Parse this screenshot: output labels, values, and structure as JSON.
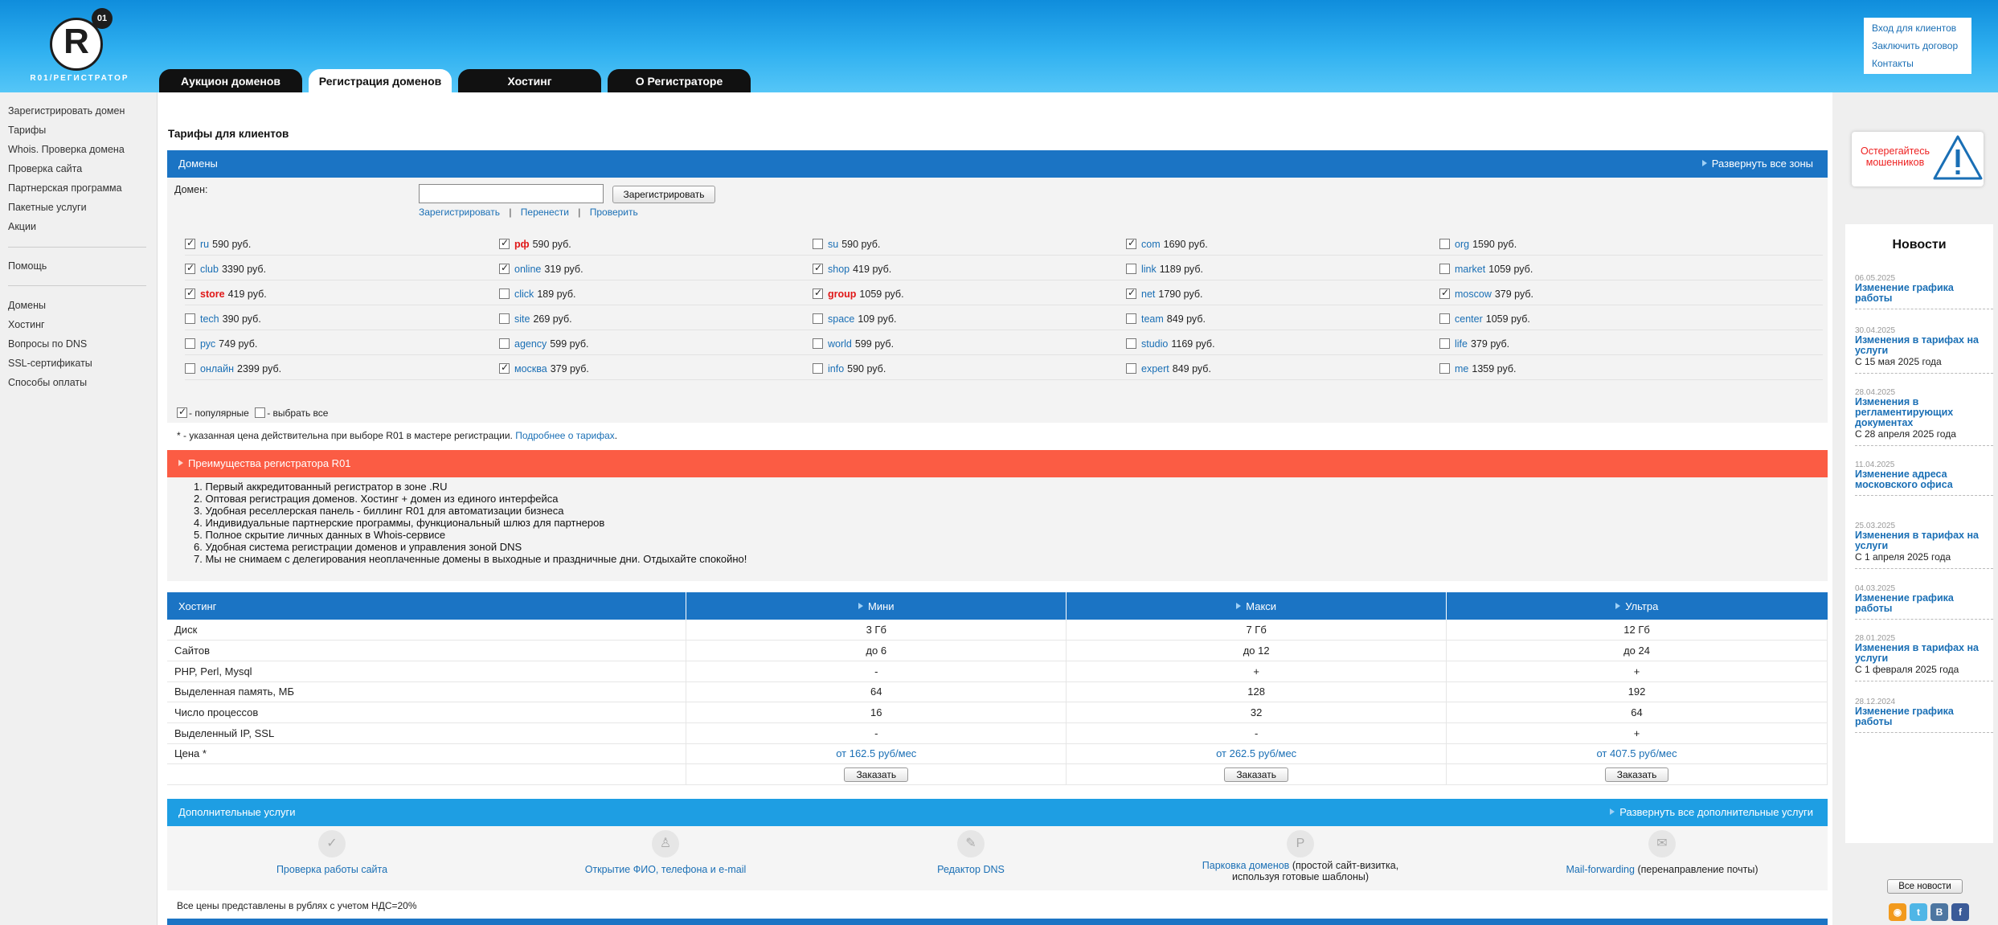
{
  "header": {
    "logo_badge": "01",
    "logo_letter": "R",
    "logo_text": "R01/РЕГИСТРАТОР",
    "tabs": [
      {
        "label": "Аукцион доменов"
      },
      {
        "label": "Регистрация доменов"
      },
      {
        "label": "Хостинг"
      },
      {
        "label": "О Регистраторе"
      }
    ],
    "top_links": [
      "Вход для клиентов",
      "Заключить договор",
      "Контакты"
    ]
  },
  "sidebar": {
    "group1": [
      "Зарегистрировать домен",
      "Тарифы",
      "Whois. Проверка домена",
      "Проверка сайта",
      "Партнерская программа",
      "Пакетные услуги",
      "Акции"
    ],
    "group2": [
      "Помощь"
    ],
    "group3": [
      "Домены",
      "Хостинг",
      "Вопросы по DNS",
      "SSL-сертификаты",
      "Способы оплаты"
    ]
  },
  "main": {
    "title": "Тарифы для клиентов",
    "domains": {
      "bar_title": "Домены",
      "expand_label": "Развернуть все зоны",
      "domain_label": "Домен:",
      "input_value": "",
      "register_button": "Зарегистрировать",
      "actions": [
        "Зарегистрировать",
        "|",
        "Перенести",
        "|",
        "Проверить"
      ],
      "zones": [
        [
          {
            "zone": "ru",
            "price": "590 руб.",
            "checked": true,
            "red": false
          },
          {
            "zone": "рф",
            "price": "590 руб.",
            "checked": true,
            "red": true
          },
          {
            "zone": "su",
            "price": "590 руб.",
            "checked": false,
            "red": false
          },
          {
            "zone": "com",
            "price": "1690 руб.",
            "checked": true,
            "red": false
          },
          {
            "zone": "org",
            "price": "1590 руб.",
            "checked": false,
            "red": false
          }
        ],
        [
          {
            "zone": "club",
            "price": "3390 руб.",
            "checked": true,
            "red": false
          },
          {
            "zone": "online",
            "price": "319 руб.",
            "checked": true,
            "red": false
          },
          {
            "zone": "shop",
            "price": "419 руб.",
            "checked": true,
            "red": false
          },
          {
            "zone": "link",
            "price": "1189 руб.",
            "checked": false,
            "red": false
          },
          {
            "zone": "market",
            "price": "1059 руб.",
            "checked": false,
            "red": false
          }
        ],
        [
          {
            "zone": "store",
            "price": "419 руб.",
            "checked": true,
            "red": true
          },
          {
            "zone": "click",
            "price": "189 руб.",
            "checked": false,
            "red": false
          },
          {
            "zone": "group",
            "price": "1059 руб.",
            "checked": true,
            "red": true
          },
          {
            "zone": "net",
            "price": "1790 руб.",
            "checked": true,
            "red": false
          },
          {
            "zone": "moscow",
            "price": "379 руб.",
            "checked": true,
            "red": false
          }
        ],
        [
          {
            "zone": "tech",
            "price": "390 руб.",
            "checked": false,
            "red": false
          },
          {
            "zone": "site",
            "price": "269 руб.",
            "checked": false,
            "red": false
          },
          {
            "zone": "space",
            "price": "109 руб.",
            "checked": false,
            "red": false
          },
          {
            "zone": "team",
            "price": "849 руб.",
            "checked": false,
            "red": false
          },
          {
            "zone": "center",
            "price": "1059 руб.",
            "checked": false,
            "red": false
          }
        ],
        [
          {
            "zone": "рус",
            "price": "749 руб.",
            "checked": false,
            "red": false
          },
          {
            "zone": "agency",
            "price": "599 руб.",
            "checked": false,
            "red": false
          },
          {
            "zone": "world",
            "price": "599 руб.",
            "checked": false,
            "red": false
          },
          {
            "zone": "studio",
            "price": "1169 руб.",
            "checked": false,
            "red": false
          },
          {
            "zone": "life",
            "price": "379 руб.",
            "checked": false,
            "red": false
          }
        ],
        [
          {
            "zone": "онлайн",
            "price": "2399 руб.",
            "checked": false,
            "red": false
          },
          {
            "zone": "москва",
            "price": "379 руб.",
            "checked": true,
            "red": false
          },
          {
            "zone": "info",
            "price": "590 руб.",
            "checked": false,
            "red": false
          },
          {
            "zone": "expert",
            "price": "849 руб.",
            "checked": false,
            "red": false
          },
          {
            "zone": "me",
            "price": "1359 руб.",
            "checked": false,
            "red": false
          }
        ]
      ],
      "legend_popular": "- популярные",
      "legend_all": "- выбрать все",
      "note": "* - указанная цена действительна при выборе R01 в мастере регистрации.",
      "note_link": "Подробнее о тарифах",
      "note_end": "."
    },
    "advantages": {
      "title": "Преимущества регистратора R01",
      "items": [
        "Первый аккредитованный регистратор в зоне .RU",
        "Оптовая регистрация доменов. Хостинг + домен из единого интерфейса",
        "Удобная реселлерская панель - биллинг R01 для автоматизации бизнеса",
        "Индивидуальные партнерские программы, функциональный шлюз для партнеров",
        "Полное скрытие личных данных в Whois-сервисе",
        "Удобная система регистрации доменов и управления зоной DNS",
        "Мы не снимаем с делегирования неоплаченные домены в выходные и праздничные дни. Отдыхайте спокойно!"
      ]
    },
    "hosting": {
      "header": [
        "Хостинг",
        "Мини",
        "Макси",
        "Ультра"
      ],
      "rows": [
        [
          "Диск",
          "3 Гб",
          "7 Гб",
          "12 Гб"
        ],
        [
          "Сайтов",
          "до 6",
          "до 12",
          "до 24"
        ],
        [
          "PHP, Perl, Mysql",
          "-",
          "+",
          "+"
        ],
        [
          "Выделенная память, МБ",
          "64",
          "128",
          "192"
        ],
        [
          "Число процессов",
          "16",
          "32",
          "64"
        ],
        [
          "Выделенный IP, SSL",
          "-",
          "-",
          "+"
        ]
      ],
      "price_label": "Цена *",
      "prices": [
        "от 162.5 руб/мес",
        "от 262.5 руб/мес",
        "от 407.5 руб/мес"
      ],
      "order_label": "Заказать"
    },
    "extra": {
      "title": "Дополнительные услуги",
      "expand_label": "Развернуть все дополнительные услуги",
      "services": [
        {
          "link": "Проверка работы сайта",
          "desc": ""
        },
        {
          "link": "Открытие ФИО, телефона и e-mail",
          "desc": ""
        },
        {
          "link": "Редактор DNS",
          "desc": ""
        },
        {
          "link": "Парковка доменов",
          "desc": "(простой сайт-визитка, используя готовые шаблоны)"
        },
        {
          "link": "Mail-forwarding",
          "desc": "(перенаправление почты)"
        }
      ],
      "vat_note": "Все цены представлены в рублях с учетом НДС=20%"
    }
  },
  "right": {
    "warning": "Остерегайтесь мошенников",
    "news_title": "Новости",
    "news": [
      {
        "date": "06.05.2025",
        "title": "Изменение графика работы",
        "sub": ""
      },
      {
        "date": "30.04.2025",
        "title": "Изменения в тарифах на услуги",
        "sub": "С 15 мая 2025 года"
      },
      {
        "date": "28.04.2025",
        "title": "Изменения в регламентирующих документах",
        "sub": "С 28 апреля 2025 года"
      },
      {
        "date": "11.04.2025",
        "title": "Изменение адреса московского офиса",
        "sub": ""
      },
      {
        "date": "25.03.2025",
        "title": "Изменения в тарифах на услуги",
        "sub": "С 1 апреля 2025 года"
      },
      {
        "date": "04.03.2025",
        "title": "Изменение графика работы",
        "sub": ""
      },
      {
        "date": "28.01.2025",
        "title": "Изменения в тарифах на услуги",
        "sub": "С 1 февраля 2025 года"
      },
      {
        "date": "28.12.2024",
        "title": "Изменение графика работы",
        "sub": ""
      }
    ],
    "all_news": "Все новости",
    "social": [
      {
        "icon": "rss-icon",
        "glyph": "◉",
        "color": "#f29a1d"
      },
      {
        "icon": "twitter-icon",
        "glyph": "t",
        "color": "#4fb6e6"
      },
      {
        "icon": "vk-icon",
        "glyph": "B",
        "color": "#4d76a1"
      },
      {
        "icon": "facebook-icon",
        "glyph": "f",
        "color": "#3b5b98"
      }
    ]
  }
}
